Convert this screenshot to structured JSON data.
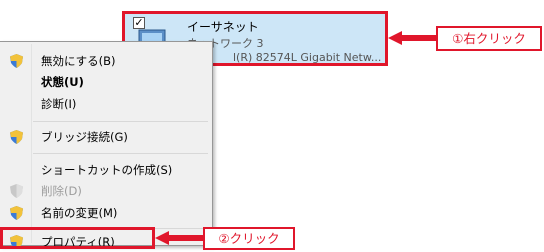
{
  "adapter": {
    "name": "イーサネット",
    "network": "ネットワーク 3",
    "description": "Intel(R) 82574L Gigabit Netw...",
    "description_visible": "l(R) 82574L Gigabit Netw..."
  },
  "context_menu": {
    "items": [
      {
        "label": "無効にする(B)",
        "shield": true
      },
      {
        "label": "状態(U)",
        "bold": true
      },
      {
        "label": "診断(I)"
      },
      {
        "label": "ブリッジ接続(G)",
        "shield": true
      },
      {
        "label": "ショートカットの作成(S)"
      },
      {
        "label": "削除(D)",
        "shield": true,
        "disabled": true
      },
      {
        "label": "名前の変更(M)",
        "shield": true
      },
      {
        "label": "プロパティ(R)",
        "shield": true
      }
    ]
  },
  "callouts": {
    "step1": "①右クリック",
    "step2": "②クリック"
  },
  "colors": {
    "annotation_red": "#e0162b",
    "selection_blue": "#cde6f7",
    "menu_bg": "#f0f0f0"
  }
}
